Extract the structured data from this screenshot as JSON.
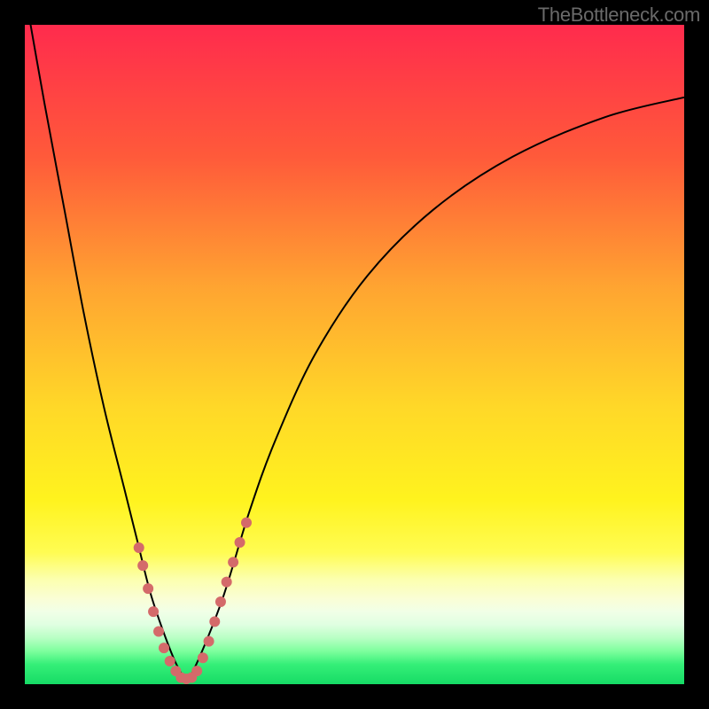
{
  "watermark": "TheBottleneck.com",
  "gradient_stops": [
    {
      "offset": 0.0,
      "color": "#ff2b4d"
    },
    {
      "offset": 0.2,
      "color": "#ff5a3a"
    },
    {
      "offset": 0.4,
      "color": "#ffa531"
    },
    {
      "offset": 0.58,
      "color": "#ffd828"
    },
    {
      "offset": 0.72,
      "color": "#fff31e"
    },
    {
      "offset": 0.8,
      "color": "#fffc52"
    },
    {
      "offset": 0.84,
      "color": "#fcffad"
    },
    {
      "offset": 0.87,
      "color": "#fafed5"
    },
    {
      "offset": 0.89,
      "color": "#f1ffe7"
    },
    {
      "offset": 0.91,
      "color": "#dfffe1"
    },
    {
      "offset": 0.93,
      "color": "#b8ffc4"
    },
    {
      "offset": 0.95,
      "color": "#7dff9d"
    },
    {
      "offset": 0.97,
      "color": "#35ef78"
    },
    {
      "offset": 1.0,
      "color": "#16db65"
    }
  ],
  "curve_color": "#000000",
  "curve_width": 2,
  "point_series": {
    "color": "#d46a6a",
    "radius": 6
  },
  "chart_data": {
    "type": "line",
    "title": "",
    "xlabel": "",
    "ylabel": "",
    "xlim": [
      0,
      100
    ],
    "ylim": [
      0,
      100
    ],
    "note": "Axes are unlabeled; values are fractional estimates of plot-area coordinates (0 = left/top, 100 = right/bottom of the gradient box).",
    "series": [
      {
        "name": "bottleneck-curve",
        "role": "line",
        "x": [
          0.0,
          3.0,
          6.0,
          9.0,
          12.0,
          15.0,
          17.0,
          19.0,
          21.0,
          23.0,
          24.5,
          26.0,
          30.0,
          34.0,
          38.0,
          44.0,
          52.0,
          62.0,
          74.0,
          88.0,
          100.0
        ],
        "y": [
          -5.0,
          12.0,
          28.0,
          44.0,
          58.0,
          70.0,
          78.0,
          86.0,
          92.0,
          97.0,
          99.0,
          97.0,
          87.0,
          74.0,
          63.0,
          50.0,
          38.0,
          28.0,
          20.0,
          14.0,
          11.0
        ]
      },
      {
        "name": "data-points",
        "role": "scatter",
        "x": [
          17.3,
          17.9,
          18.7,
          19.5,
          20.3,
          21.1,
          22.0,
          22.9,
          23.7,
          24.5,
          25.3,
          26.1,
          27.0,
          27.9,
          28.8,
          29.7,
          30.6,
          31.6,
          32.6,
          33.6
        ],
        "y": [
          79.3,
          82.0,
          85.5,
          89.0,
          92.0,
          94.5,
          96.5,
          98.0,
          99.0,
          99.2,
          99.0,
          98.0,
          96.0,
          93.5,
          90.5,
          87.5,
          84.5,
          81.5,
          78.5,
          75.5
        ]
      }
    ]
  }
}
